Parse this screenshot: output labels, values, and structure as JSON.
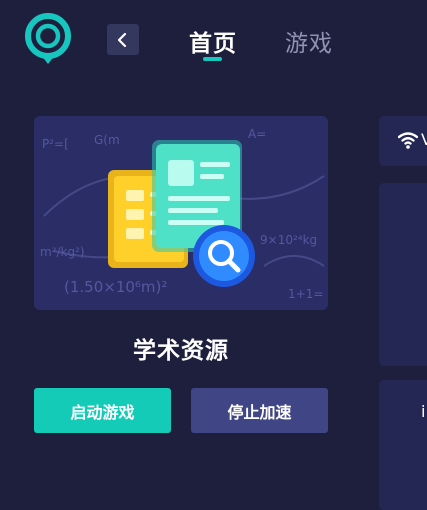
{
  "header": {
    "tabs": [
      {
        "label": "首页",
        "active": true
      },
      {
        "label": "游戏",
        "active": false
      }
    ]
  },
  "card": {
    "title": "学术资源",
    "start_label": "启动游戏",
    "stop_label": "停止加速",
    "banner_formulas": [
      "P²=[",
      "G(m",
      "A=",
      "m²/kg²)",
      "(1.50×10⁶m)²",
      "9×10²⁴kg",
      "1+1="
    ]
  },
  "side_panel": {
    "top_char": "V",
    "bottom_char": "i"
  },
  "colors": {
    "background": "#1d1f3d",
    "accent": "#14cbb8",
    "secondary_button": "#404585",
    "panel": "#242753"
  }
}
